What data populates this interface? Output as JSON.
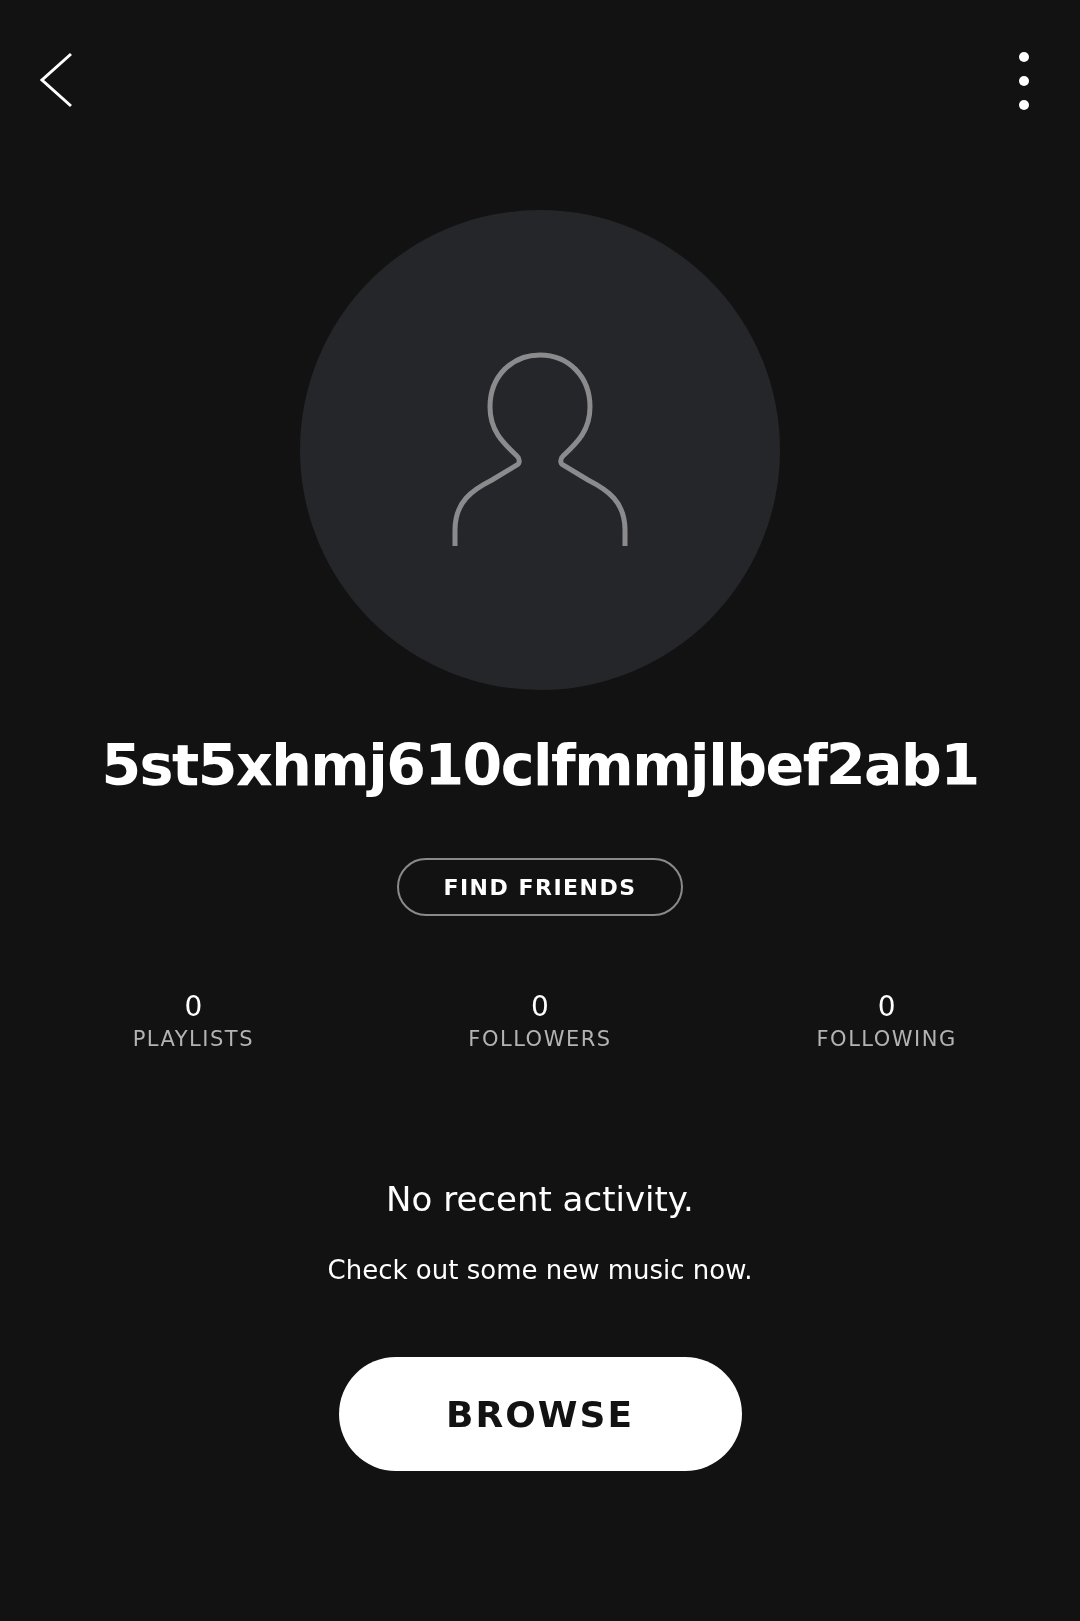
{
  "profile": {
    "username": "5st5xhmj610clfmmjlbef2ab1",
    "action": "FIND FRIENDS"
  },
  "stats": [
    {
      "value": "0",
      "label": "PLAYLISTS"
    },
    {
      "value": "0",
      "label": "FOLLOWERS"
    },
    {
      "value": "0",
      "label": "FOLLOWING"
    }
  ],
  "activity": {
    "title": "No recent activity.",
    "subtitle": "Check out some new music now.",
    "button": "BROWSE"
  }
}
